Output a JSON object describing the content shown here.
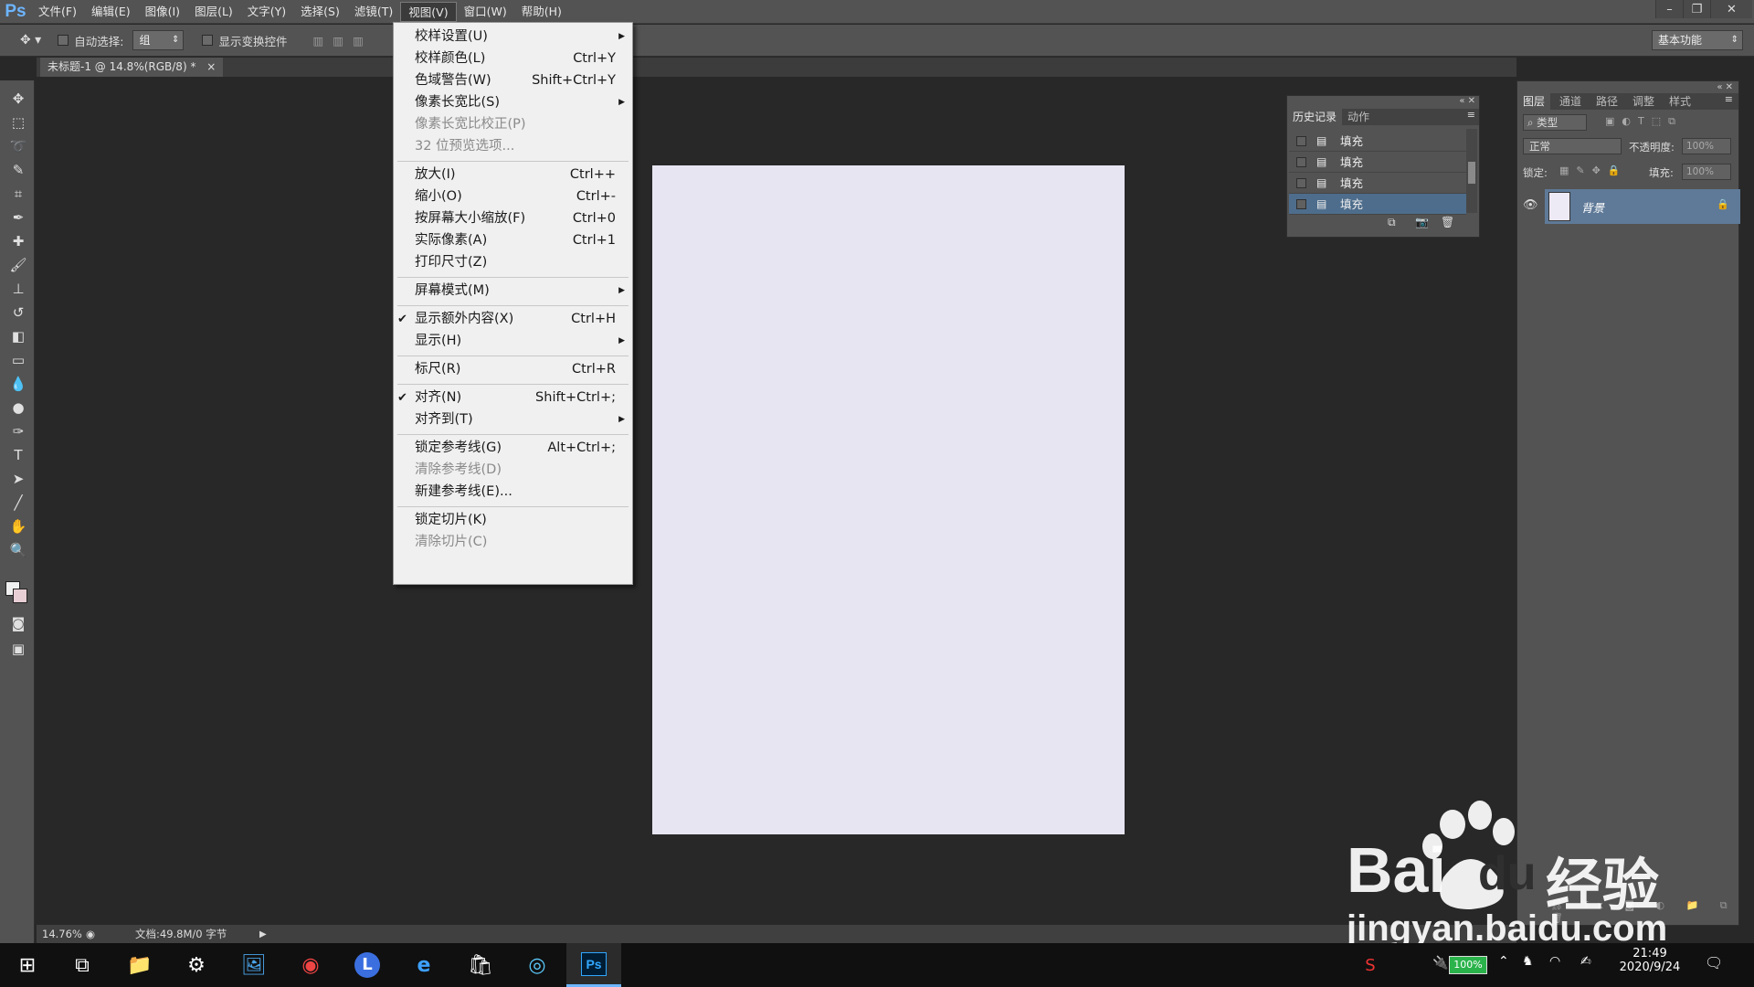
{
  "app": {
    "logo": "Ps"
  },
  "menubar": {
    "items": [
      "文件(F)",
      "编辑(E)",
      "图像(I)",
      "图层(L)",
      "文字(Y)",
      "选择(S)",
      "滤镜(T)",
      "视图(V)",
      "窗口(W)",
      "帮助(H)"
    ],
    "active_index": 7
  },
  "options": {
    "auto_select_label": "自动选择:",
    "auto_select_value": "组",
    "show_transform_label": "显示变换控件",
    "workspace": "基本功能"
  },
  "document": {
    "tab_title": "未标题-1 @ 14.8%(RGB/8) *",
    "zoom": "14.76%",
    "doc_info": "文档:49.8M/0 字节"
  },
  "view_menu": {
    "items": [
      {
        "label": "校样设置(U)",
        "shortcut": "",
        "submenu": true,
        "disabled": false,
        "checked": false
      },
      {
        "label": "校样颜色(L)",
        "shortcut": "Ctrl+Y",
        "submenu": false,
        "disabled": false,
        "checked": false
      },
      {
        "label": "色域警告(W)",
        "shortcut": "Shift+Ctrl+Y",
        "submenu": false,
        "disabled": false,
        "checked": false
      },
      {
        "label": "像素长宽比(S)",
        "shortcut": "",
        "submenu": true,
        "disabled": false,
        "checked": false
      },
      {
        "label": "像素长宽比校正(P)",
        "shortcut": "",
        "submenu": false,
        "disabled": true,
        "checked": false
      },
      {
        "label": "32 位预览选项...",
        "shortcut": "",
        "submenu": false,
        "disabled": true,
        "checked": false
      },
      {
        "sep": true
      },
      {
        "label": "放大(I)",
        "shortcut": "Ctrl++",
        "submenu": false,
        "disabled": false,
        "checked": false
      },
      {
        "label": "缩小(O)",
        "shortcut": "Ctrl+-",
        "submenu": false,
        "disabled": false,
        "checked": false
      },
      {
        "label": "按屏幕大小缩放(F)",
        "shortcut": "Ctrl+0",
        "submenu": false,
        "disabled": false,
        "checked": false
      },
      {
        "label": "实际像素(A)",
        "shortcut": "Ctrl+1",
        "submenu": false,
        "disabled": false,
        "checked": false
      },
      {
        "label": "打印尺寸(Z)",
        "shortcut": "",
        "submenu": false,
        "disabled": false,
        "checked": false
      },
      {
        "sep": true
      },
      {
        "label": "屏幕模式(M)",
        "shortcut": "",
        "submenu": true,
        "disabled": false,
        "checked": false
      },
      {
        "sep": true
      },
      {
        "label": "显示额外内容(X)",
        "shortcut": "Ctrl+H",
        "submenu": false,
        "disabled": false,
        "checked": true
      },
      {
        "label": "显示(H)",
        "shortcut": "",
        "submenu": true,
        "disabled": false,
        "checked": false
      },
      {
        "sep": true
      },
      {
        "label": "标尺(R)",
        "shortcut": "Ctrl+R",
        "submenu": false,
        "disabled": false,
        "checked": false
      },
      {
        "sep": true
      },
      {
        "label": "对齐(N)",
        "shortcut": "Shift+Ctrl+;",
        "submenu": false,
        "disabled": false,
        "checked": true
      },
      {
        "label": "对齐到(T)",
        "shortcut": "",
        "submenu": true,
        "disabled": false,
        "checked": false
      },
      {
        "sep": true
      },
      {
        "label": "锁定参考线(G)",
        "shortcut": "Alt+Ctrl+;",
        "submenu": false,
        "disabled": false,
        "checked": false
      },
      {
        "label": "清除参考线(D)",
        "shortcut": "",
        "submenu": false,
        "disabled": true,
        "checked": false
      },
      {
        "label": "新建参考线(E)...",
        "shortcut": "",
        "submenu": false,
        "disabled": false,
        "checked": false
      },
      {
        "sep": true
      },
      {
        "label": "锁定切片(K)",
        "shortcut": "",
        "submenu": false,
        "disabled": false,
        "checked": false
      },
      {
        "label": "清除切片(C)",
        "shortcut": "",
        "submenu": false,
        "disabled": true,
        "checked": false
      }
    ]
  },
  "history_panel": {
    "tabs": [
      "历史记录",
      "动作"
    ],
    "rows": [
      "填充",
      "填充",
      "填充",
      "填充"
    ],
    "selected_index": 3
  },
  "layers_panel": {
    "tabs": [
      "图层",
      "通道",
      "路径",
      "调整",
      "样式"
    ],
    "filter_label": "类型",
    "blend_mode": "正常",
    "opacity_label": "不透明度:",
    "opacity_value": "100%",
    "lock_label": "锁定:",
    "fill_label": "填充:",
    "fill_value": "100%",
    "layer_name": "背景"
  },
  "taskbar": {
    "battery": "100%",
    "time": "21:49",
    "date": "2020/9/24"
  },
  "watermark": {
    "brand": "Bai",
    "brand2": "du",
    "cn": "经验",
    "url": "jingyan.baidu.com"
  },
  "colors": {
    "accent_blue": "#4e6d8c",
    "canvas": "#e7e5f2",
    "ps_blue": "#6db5ff"
  }
}
